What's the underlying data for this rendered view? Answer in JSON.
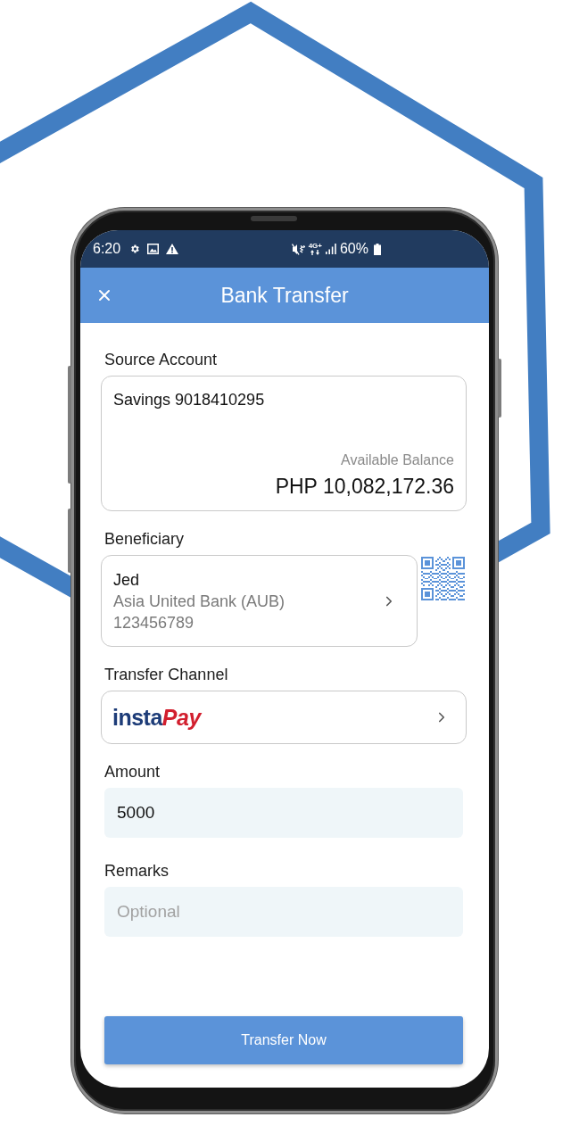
{
  "status_bar": {
    "time": "6:20",
    "network": "4G+",
    "battery": "60%"
  },
  "header": {
    "title": "Bank Transfer"
  },
  "source_account": {
    "label": "Source Account",
    "account": "Savings 9018410295",
    "balance_label": "Available Balance",
    "balance": "PHP 10,082,172.36"
  },
  "beneficiary": {
    "label": "Beneficiary",
    "name": "Jed",
    "bank": "Asia United Bank (AUB)",
    "account_number": "123456789"
  },
  "transfer_channel": {
    "label": "Transfer Channel",
    "logo": [
      "insta",
      "Pay"
    ]
  },
  "fields": [
    {
      "label": "Amount",
      "value": "5000"
    },
    {
      "label": "Remarks",
      "placeholder": "Optional"
    }
  ],
  "primary_button": {
    "label": "Transfer Now"
  }
}
